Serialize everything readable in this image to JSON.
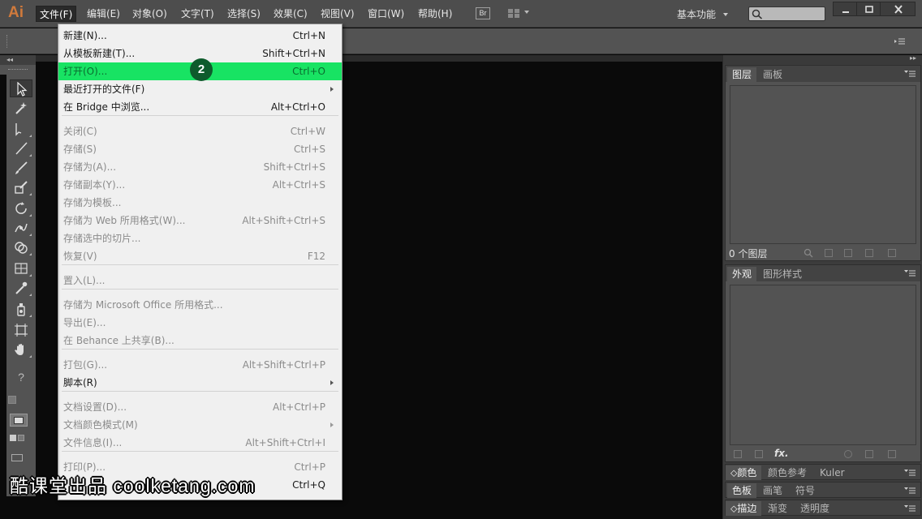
{
  "app": {
    "logo": "Ai",
    "bridge_button": "Br",
    "workspace": "基本功能"
  },
  "menubar": {
    "items": [
      "文件(F)",
      "编辑(E)",
      "对象(O)",
      "文字(T)",
      "选择(S)",
      "效果(C)",
      "视图(V)",
      "窗口(W)",
      "帮助(H)"
    ],
    "active": "文件(F)"
  },
  "file_menu": {
    "items": [
      {
        "label": "新建(N)...",
        "shortcut": "Ctrl+N",
        "enabled": true
      },
      {
        "label": "从模板新建(T)...",
        "shortcut": "Shift+Ctrl+N",
        "enabled": true
      },
      {
        "label": "打开(O)...",
        "shortcut": "Ctrl+O",
        "enabled": true,
        "highlighted": true
      },
      {
        "label": "最近打开的文件(F)",
        "shortcut": "",
        "enabled": true,
        "submenu": true
      },
      {
        "label": "在 Bridge 中浏览...",
        "shortcut": "Alt+Ctrl+O",
        "enabled": true
      },
      {
        "label": "关闭(C)",
        "shortcut": "Ctrl+W",
        "enabled": false
      },
      {
        "label": "存储(S)",
        "shortcut": "Ctrl+S",
        "enabled": false
      },
      {
        "label": "存储为(A)...",
        "shortcut": "Shift+Ctrl+S",
        "enabled": false
      },
      {
        "label": "存储副本(Y)...",
        "shortcut": "Alt+Ctrl+S",
        "enabled": false
      },
      {
        "label": "存储为模板...",
        "shortcut": "",
        "enabled": false
      },
      {
        "label": "存储为 Web 所用格式(W)...",
        "shortcut": "Alt+Shift+Ctrl+S",
        "enabled": false
      },
      {
        "label": "存储选中的切片...",
        "shortcut": "",
        "enabled": false
      },
      {
        "label": "恢复(V)",
        "shortcut": "F12",
        "enabled": false
      },
      {
        "label": "置入(L)...",
        "shortcut": "",
        "enabled": false
      },
      {
        "label": "存储为 Microsoft Office 所用格式...",
        "shortcut": "",
        "enabled": false
      },
      {
        "label": "导出(E)...",
        "shortcut": "",
        "enabled": false
      },
      {
        "label": "在 Behance 上共享(B)...",
        "shortcut": "",
        "enabled": false
      },
      {
        "label": "打包(G)...",
        "shortcut": "Alt+Shift+Ctrl+P",
        "enabled": false
      },
      {
        "label": "脚本(R)",
        "shortcut": "",
        "enabled": true,
        "submenu": true
      },
      {
        "label": "文档设置(D)...",
        "shortcut": "Alt+Ctrl+P",
        "enabled": false
      },
      {
        "label": "文档颜色模式(M)",
        "shortcut": "",
        "enabled": false,
        "submenu": true
      },
      {
        "label": "文件信息(I)...",
        "shortcut": "Alt+Shift+Ctrl+I",
        "enabled": false
      },
      {
        "label": "打印(P)...",
        "shortcut": "Ctrl+P",
        "enabled": false
      },
      {
        "label": "",
        "shortcut": "Ctrl+Q",
        "enabled": true
      }
    ],
    "step_badge": "2",
    "highlight_color": "#18e363"
  },
  "panels": {
    "layers": {
      "tabs": [
        "图层",
        "画板"
      ],
      "status": "0 个图层"
    },
    "appearance": {
      "tabs": [
        "外观",
        "图形样式"
      ],
      "footer_fx": "fx."
    },
    "color": {
      "tabs": [
        "颜色",
        "颜色参考",
        "Kuler"
      ]
    },
    "swatches": {
      "tabs": [
        "色板",
        "画笔",
        "符号"
      ]
    },
    "stroke": {
      "tabs": [
        "描边",
        "渐变",
        "透明度"
      ]
    }
  },
  "watermark": "酷课堂出品 coolketang.com",
  "colors": {
    "logo": "#d07a3c",
    "menubar": "#4d4d4d",
    "panel": "#535353",
    "canvas": "#0a0a0a"
  }
}
